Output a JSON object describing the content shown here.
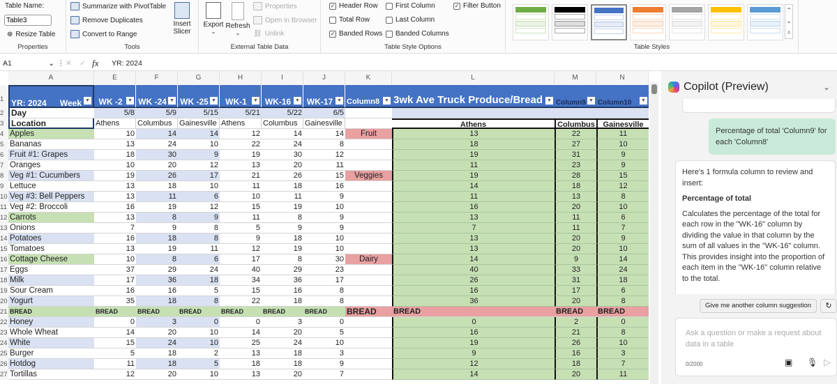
{
  "ribbon": {
    "properties": {
      "table_name_label": "Table Name:",
      "table_name_value": "Table3",
      "resize": "Resize Table",
      "group": "Properties"
    },
    "tools": {
      "pivot": "Summarize with PivotTable",
      "dedupe": "Remove Duplicates",
      "convert": "Convert to Range",
      "slicer1": "Insert",
      "slicer2": "Slicer",
      "group": "Tools"
    },
    "external": {
      "export": "Export",
      "refresh": "Refresh",
      "properties": "Properties",
      "open_browser": "Open in Browser",
      "unlink": "Unlink",
      "group": "External Table Data"
    },
    "style_options": {
      "header_row": "Header Row",
      "total_row": "Total Row",
      "banded_rows": "Banded Rows",
      "first_column": "First Column",
      "last_column": "Last Column",
      "banded_columns": "Banded Columns",
      "filter_button": "Filter Button",
      "group": "Table Style Options",
      "checked": {
        "header_row": true,
        "total_row": false,
        "banded_rows": true,
        "first_column": false,
        "last_column": false,
        "banded_columns": false,
        "filter_button": true
      }
    },
    "table_styles": {
      "group": "Table Styles",
      "swatches": [
        "#70ad47",
        "#000000",
        "#4472c4",
        "#ed7d31",
        "#a5a5a5",
        "#ffc000",
        "#5b9bd5"
      ],
      "selected": 2
    }
  },
  "formula_bar": {
    "cell_ref": "A1",
    "fx": "fx",
    "value": "YR:  2024"
  },
  "columns": [
    "A",
    "E",
    "F",
    "G",
    "H",
    "I",
    "J",
    "K",
    "L",
    "M",
    "N"
  ],
  "header_row": {
    "a": "YR:  2024",
    "a2": "Week",
    "weeks": [
      "WK -2",
      "WK -24",
      "WK -25",
      "WK-1",
      "WK-16",
      "WK-17"
    ],
    "k": "Column8",
    "l": "3wk Ave Truck Produce/Bread",
    "m": "Column9",
    "n": "Column10"
  },
  "day_row": {
    "label": "Day",
    "values": [
      "5/8",
      "5/9",
      "5/15",
      "5/21",
      "5/22",
      "6/5"
    ]
  },
  "location_row": {
    "label": "Location",
    "values": [
      "Athens",
      "Columbus",
      "Gainesville",
      "Athens",
      "Columbus",
      "Gainesville"
    ],
    "l": "Athens",
    "m": "Columbus",
    "n": "Gainesville"
  },
  "rows": [
    {
      "n": 4,
      "label": "Apples",
      "v": [
        10,
        14,
        14,
        12,
        14,
        14
      ],
      "k": "Fruit",
      "l": 13,
      "m": 22,
      "nn": 11,
      "green": true
    },
    {
      "n": 5,
      "label": "Bananas",
      "v": [
        13,
        24,
        10,
        22,
        24,
        8
      ],
      "l": 18,
      "m": 27,
      "nn": 10
    },
    {
      "n": 6,
      "label": "Fruit #1: Grapes",
      "v": [
        18,
        30,
        9,
        19,
        30,
        12
      ],
      "l": 19,
      "m": 31,
      "nn": 9
    },
    {
      "n": 7,
      "label": "Oranges",
      "v": [
        10,
        20,
        12,
        13,
        20,
        11
      ],
      "l": 11,
      "m": 23,
      "nn": 9
    },
    {
      "n": 8,
      "label": "Veg #1: Cucumbers",
      "v": [
        19,
        26,
        17,
        21,
        26,
        15
      ],
      "k": "Veggies",
      "l": 19,
      "m": 28,
      "nn": 15
    },
    {
      "n": 9,
      "label": "Lettuce",
      "v": [
        13,
        18,
        10,
        11,
        18,
        16
      ],
      "l": 14,
      "m": 18,
      "nn": 12
    },
    {
      "n": 10,
      "label": "Veg #3: Bell Peppers",
      "v": [
        13,
        11,
        6,
        10,
        11,
        9
      ],
      "l": 11,
      "m": 13,
      "nn": 8
    },
    {
      "n": 11,
      "label": "Veg #2: Broccoli",
      "v": [
        16,
        19,
        12,
        15,
        19,
        10
      ],
      "l": 16,
      "m": 20,
      "nn": 10
    },
    {
      "n": 12,
      "label": "Carrots",
      "v": [
        13,
        8,
        9,
        11,
        8,
        9
      ],
      "l": 13,
      "m": 11,
      "nn": 6,
      "green": true
    },
    {
      "n": 13,
      "label": "Onions",
      "v": [
        7,
        9,
        8,
        5,
        9,
        9
      ],
      "l": 7,
      "m": 11,
      "nn": 7
    },
    {
      "n": 14,
      "label": "Potatoes",
      "v": [
        16,
        18,
        8,
        9,
        18,
        10
      ],
      "l": 13,
      "m": 20,
      "nn": 9
    },
    {
      "n": 15,
      "label": "Tomatoes",
      "v": [
        13,
        19,
        11,
        12,
        19,
        10
      ],
      "l": 13,
      "m": 20,
      "nn": 10
    },
    {
      "n": 16,
      "label": "Cottage Cheese",
      "v": [
        10,
        8,
        6,
        17,
        8,
        30
      ],
      "k": "Dairy",
      "l": 14,
      "m": 9,
      "nn": 14,
      "green": true
    },
    {
      "n": 17,
      "label": "Eggs",
      "v": [
        37,
        29,
        24,
        40,
        29,
        23
      ],
      "l": 40,
      "m": 33,
      "nn": 24
    },
    {
      "n": 18,
      "label": "Milk",
      "v": [
        17,
        36,
        18,
        34,
        36,
        17
      ],
      "l": 26,
      "m": 31,
      "nn": 18
    },
    {
      "n": 19,
      "label": "Sour Cream",
      "v": [
        16,
        16,
        5,
        15,
        16,
        8
      ],
      "l": 16,
      "m": 17,
      "nn": 6
    },
    {
      "n": 20,
      "label": "Yogurt",
      "v": [
        35,
        18,
        8,
        22,
        18,
        8
      ],
      "l": 36,
      "m": 20,
      "nn": 8
    },
    {
      "n": 21,
      "label": "BREAD",
      "v": [
        "BREAD",
        "BREAD",
        "BREAD",
        "BREAD",
        "BREAD",
        "BREAD"
      ],
      "k": "BREAD",
      "l": "BREAD",
      "m": "BREAD",
      "nn": "BREAD",
      "bread": true
    },
    {
      "n": 22,
      "label": "Honey",
      "v": [
        0,
        3,
        0,
        0,
        3,
        0
      ],
      "l": 0,
      "m": 2,
      "nn": 0
    },
    {
      "n": 23,
      "label": "Whole Wheat",
      "v": [
        14,
        20,
        10,
        14,
        20,
        5
      ],
      "l": 16,
      "m": 21,
      "nn": 8
    },
    {
      "n": 24,
      "label": "White",
      "v": [
        15,
        24,
        10,
        25,
        24,
        10
      ],
      "l": 19,
      "m": 26,
      "nn": 10
    },
    {
      "n": 25,
      "label": "Burger",
      "v": [
        5,
        18,
        2,
        13,
        18,
        3
      ],
      "l": 9,
      "m": 16,
      "nn": 3
    },
    {
      "n": 26,
      "label": "Hotdog",
      "v": [
        11,
        18,
        5,
        18,
        18,
        9
      ],
      "l": 12,
      "m": 18,
      "nn": 7
    },
    {
      "n": 27,
      "label": "Tortillas",
      "v": [
        12,
        20,
        10,
        13,
        20,
        7
      ],
      "l": 14,
      "m": 20,
      "nn": 11
    }
  ],
  "colors": {
    "header_blue": "#4472c4",
    "band_blue": "#d9e1f2",
    "green": "#c6e0b4",
    "pink": "#e8a0a0",
    "user_bubble": "#c9ead8"
  },
  "copilot": {
    "title": "Copilot (Preview)",
    "user_message": "Percentage of total 'Column9' for each 'Column8'",
    "response_intro": "Here's 1 formula column to review and insert:",
    "response_heading": "Percentage of total",
    "response_body": "Calculates the percentage of the total for each row in the \"WK-16\" column by dividing the value in that column by the sum of all values in the \"WK-16\" column. This provides insight into the proportion of each item in the \"WK-16\" column relative to the total.",
    "suggestion": "Give me another column suggestion",
    "input_placeholder": "Ask a question or make a request about data in a table",
    "char_count": "0/2000"
  }
}
